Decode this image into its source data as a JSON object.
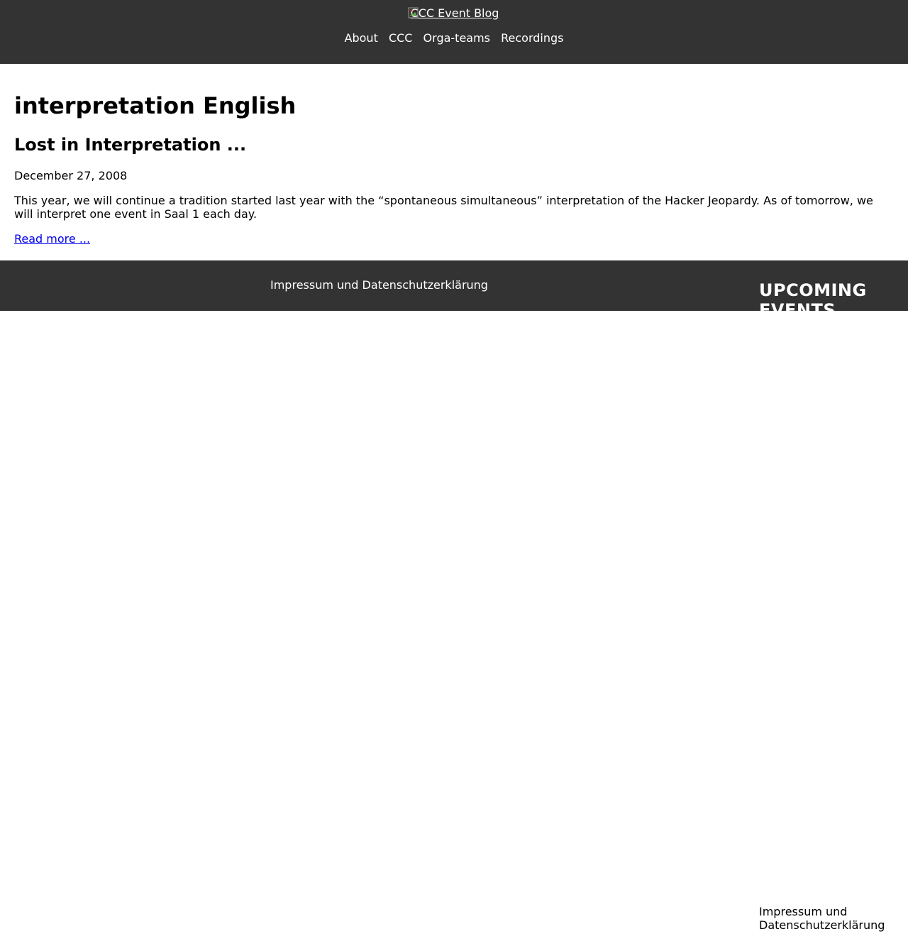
{
  "header": {
    "logo_alt": "CCC Event Blog",
    "nav": [
      {
        "label": "About"
      },
      {
        "label": "CCC"
      },
      {
        "label": "Orga-teams"
      },
      {
        "label": "Recordings"
      }
    ]
  },
  "main": {
    "archive_title": "interpretation English",
    "post": {
      "title": "Lost in Interpretation ...",
      "date": "December 27, 2008",
      "excerpt": "This year, we will continue a tradition started last year with the “spontaneous simultaneous” interpretation of the Hacker Jeopardy. As of tomorrow, we will interpret one event in Saal 1 each day.",
      "read_more": "Read more ..."
    }
  },
  "footer": {
    "imprint_link": "Impressum und Datenschutzerklärung"
  },
  "sidebar": {
    "heading": "UPCOMING EVENTS",
    "imprint_link": "Impressum und Datenschutzerklärung"
  },
  "colors": {
    "header_bg": "#333333",
    "footer_bg": "#333333",
    "link": "#0000ee"
  }
}
